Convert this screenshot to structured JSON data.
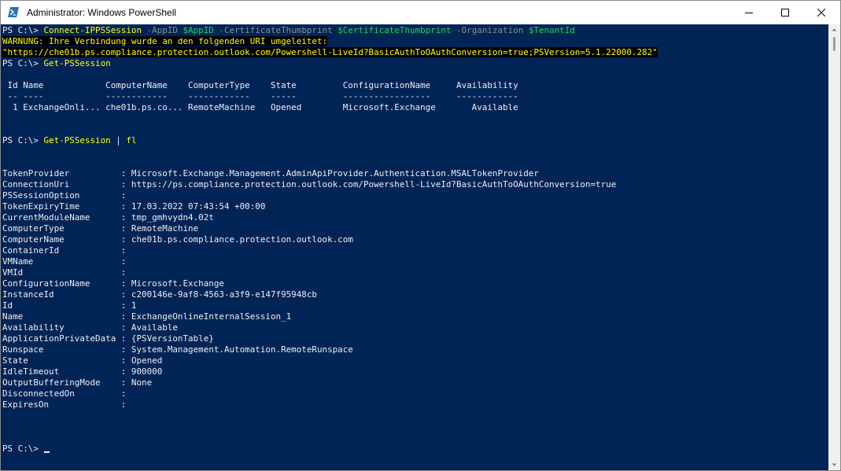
{
  "window": {
    "title": "Administrator: Windows PowerShell",
    "colors": {
      "console_bg": "#012456",
      "text": "#EEEDF0",
      "command": "#FFFF00",
      "parameter": "#8C8C8C",
      "variable": "#1CD75C",
      "warning_fg": "#FFFF00",
      "warning_bg": "#000000"
    }
  },
  "console": {
    "cmd1": {
      "prompt": "PS C:\\> ",
      "command": "Connect-IPPSSession",
      "p1": " -AppID ",
      "v1": "$AppID",
      "p2": " -CertificateThumbprint ",
      "v2": "$CertificateThumbprint",
      "p3": " -Organization ",
      "v3": "$TenantId"
    },
    "warning1": "WARNUNG: Ihre Verbindung wurde an den folgenden URI umgeleitet:",
    "warning2": "\"https://che01b.ps.compliance.protection.outlook.com/Powershell-LiveId?BasicAuthToOAuthConversion=true;PSVersion=5.1.22000.282\"",
    "cmd2": {
      "prompt": "PS C:\\> ",
      "command": "Get-PSSession"
    },
    "table": {
      "header": " Id Name            ComputerName    ComputerType    State         ConfigurationName     Availability",
      "separator": " -- ----            ------------    ------------    -----         -----------------     ------------",
      "row": "  1 ExchangeOnli... che01b.ps.co... RemoteMachine   Opened        Microsoft.Exchange       Available"
    },
    "cmd3": {
      "prompt": "PS C:\\> ",
      "command": "Get-PSSession",
      "pipe": " | ",
      "alias": "fl"
    },
    "properties": [
      "TokenProvider          : Microsoft.Exchange.Management.AdminApiProvider.Authentication.MSALTokenProvider",
      "ConnectionUri          : https://ps.compliance.protection.outlook.com/Powershell-LiveId?BasicAuthToOAuthConversion=true",
      "PSSessionOption        :",
      "TokenExpiryTime        : 17.03.2022 07:43:54 +00:00",
      "CurrentModuleName      : tmp_gmhvydn4.02t",
      "ComputerType           : RemoteMachine",
      "ComputerName           : che01b.ps.compliance.protection.outlook.com",
      "ContainerId            :",
      "VMName                 :",
      "VMId                   :",
      "ConfigurationName      : Microsoft.Exchange",
      "InstanceId             : c200146e-9af8-4563-a3f9-e147f95948cb",
      "Id                     : 1",
      "Name                   : ExchangeOnlineInternalSession_1",
      "Availability           : Available",
      "ApplicationPrivateData : {PSVersionTable}",
      "Runspace               : System.Management.Automation.RemoteRunspace",
      "State                  : Opened",
      "IdleTimeout            : 900000",
      "OutputBufferingMode    : None",
      "DisconnectedOn         :",
      "ExpiresOn              :"
    ],
    "final_prompt": "PS C:\\> "
  }
}
